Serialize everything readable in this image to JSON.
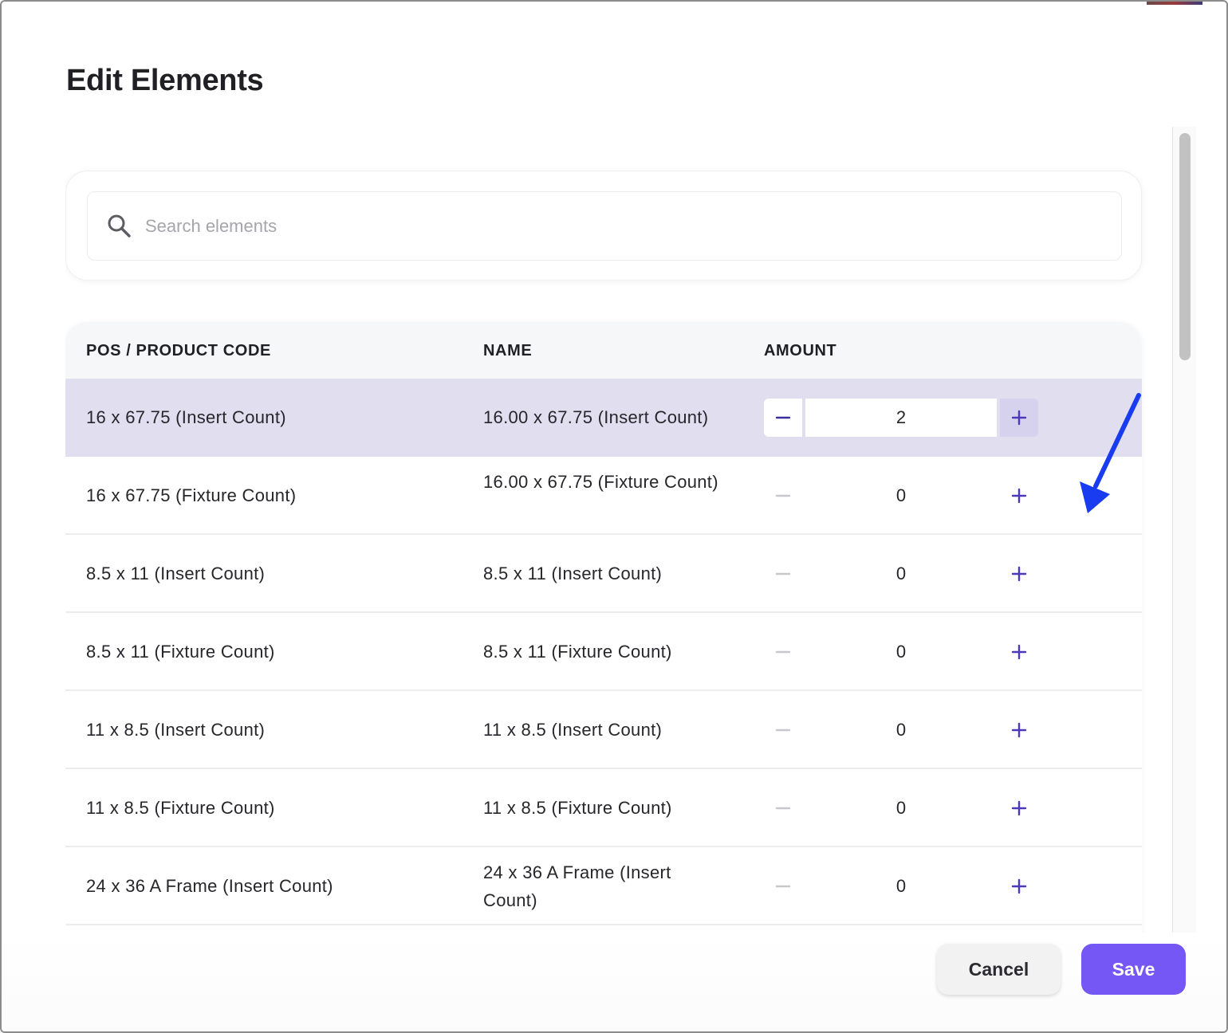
{
  "dialog": {
    "title": "Edit Elements"
  },
  "search": {
    "placeholder": "Search elements",
    "value": ""
  },
  "table": {
    "columns": {
      "code": "POS / PRODUCT CODE",
      "name": "NAME",
      "amount": "AMOUNT"
    },
    "rows": [
      {
        "code": "16 x 67.75 (Insert Count)",
        "name": "16.00 x 67.75 (Insert Count)",
        "amount": "2",
        "selected": true
      },
      {
        "code": "16 x 67.75 (Fixture Count)",
        "name": "16.00 x 67.75 (Fixture Count)",
        "amount": "0",
        "selected": false
      },
      {
        "code": "8.5 x 11 (Insert Count)",
        "name": "8.5 x 11 (Insert Count)",
        "amount": "0",
        "selected": false
      },
      {
        "code": "8.5 x 11 (Fixture Count)",
        "name": "8.5 x 11 (Fixture Count)",
        "amount": "0",
        "selected": false
      },
      {
        "code": "11 x 8.5 (Insert Count)",
        "name": "11 x 8.5 (Insert Count)",
        "amount": "0",
        "selected": false
      },
      {
        "code": "11 x 8.5 (Fixture Count)",
        "name": "11 x 8.5 (Fixture Count)",
        "amount": "0",
        "selected": false
      },
      {
        "code": "24 x 36 A Frame (Insert Count)",
        "name": "24 x 36 A Frame (Insert Count)",
        "amount": "0",
        "selected": false
      }
    ],
    "decrement_icon": "minus-icon",
    "increment_icon": "plus-icon"
  },
  "footer": {
    "cancel_label": "Cancel",
    "save_label": "Save"
  },
  "colors": {
    "accent": "#7457f5",
    "selected_row": "#e1def0",
    "annotation_arrow": "#1a3cf0"
  }
}
